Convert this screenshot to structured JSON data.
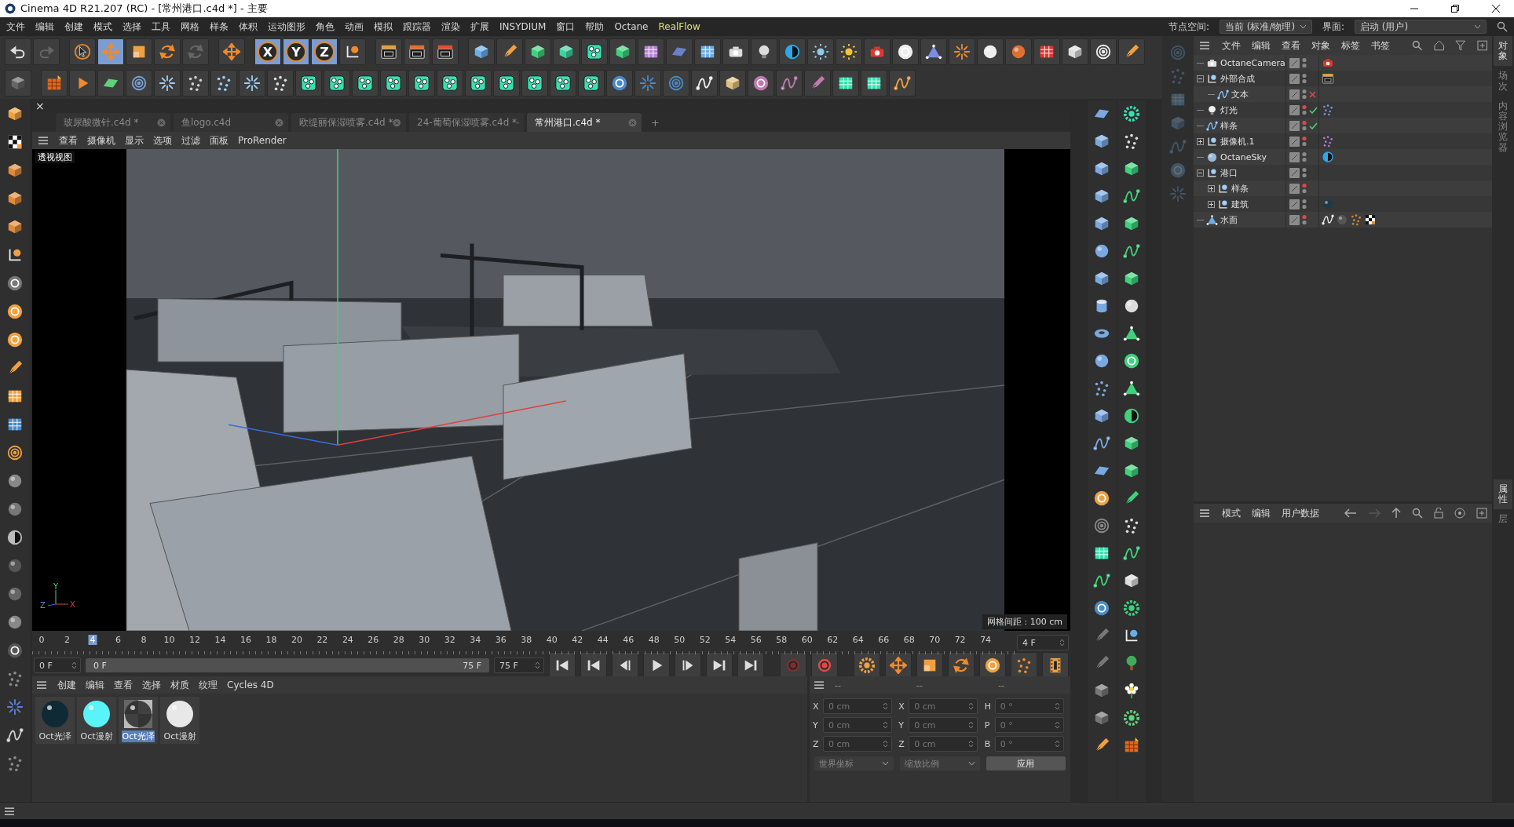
{
  "window": {
    "title": "Cinema 4D R21.207 (RC) - [常州港口.c4d *] - 主要"
  },
  "menu": [
    {
      "label": "文件"
    },
    {
      "label": "编辑"
    },
    {
      "label": "创建"
    },
    {
      "label": "模式"
    },
    {
      "label": "选择"
    },
    {
      "label": "工具"
    },
    {
      "label": "网格"
    },
    {
      "label": "样条"
    },
    {
      "label": "体积"
    },
    {
      "label": "运动图形"
    },
    {
      "label": "角色"
    },
    {
      "label": "动画"
    },
    {
      "label": "模拟"
    },
    {
      "label": "跟踪器"
    },
    {
      "label": "渲染"
    },
    {
      "label": "扩展"
    },
    {
      "label": "INSYDIUM"
    },
    {
      "label": "窗口"
    },
    {
      "label": "帮助"
    },
    {
      "label": "Octane"
    },
    {
      "label": "RealFlow",
      "color": "#d6e07e"
    }
  ],
  "node_space": {
    "label": "节点空间:",
    "value": "当前 (标准/物理)"
  },
  "layout": {
    "label": "界面:",
    "value": "启动 (用户)"
  },
  "transform_tools": [
    {
      "selected": false
    },
    {
      "selected": true
    },
    {
      "selected": false
    },
    {
      "selected": false
    }
  ],
  "axis_locks": [
    {
      "label": "X",
      "selected": true
    },
    {
      "label": "Y",
      "selected": true
    },
    {
      "label": "Z",
      "selected": true
    }
  ],
  "panel_close": "×",
  "file_tabs": [
    {
      "label": "玻尿酸微针.c4d *",
      "selected": false
    },
    {
      "label": "鱼logo.c4d",
      "selected": false
    },
    {
      "label": "欧缇丽保湿喷雾.c4d *",
      "selected": false
    },
    {
      "label": "24-葡萄保湿喷雾.c4d *",
      "selected": false
    },
    {
      "label": "常州港口.c4d *",
      "selected": true
    }
  ],
  "new_tab": "+",
  "viewport_menu": [
    "查看",
    "摄像机",
    "显示",
    "选项",
    "过滤",
    "面板",
    "ProRender"
  ],
  "viewport": {
    "label": "透视视图",
    "grid_spacing": "网格间距 : 100 cm",
    "axes": [
      "Y",
      "Z",
      "X"
    ]
  },
  "timeline": {
    "ticks": [
      {
        "label": "0",
        "selected": false
      },
      {
        "label": "2",
        "selected": false
      },
      {
        "label": "4",
        "selected": true
      },
      {
        "label": "6",
        "selected": false
      },
      {
        "label": "8",
        "selected": false
      },
      {
        "label": "10",
        "selected": false
      },
      {
        "label": "12",
        "selected": false
      },
      {
        "label": "14",
        "selected": false
      },
      {
        "label": "16",
        "selected": false
      },
      {
        "label": "18",
        "selected": false
      },
      {
        "label": "20",
        "selected": false
      },
      {
        "label": "22",
        "selected": false
      },
      {
        "label": "24",
        "selected": false
      },
      {
        "label": "26",
        "selected": false
      },
      {
        "label": "28",
        "selected": false
      },
      {
        "label": "30",
        "selected": false
      },
      {
        "label": "32",
        "selected": false
      },
      {
        "label": "34",
        "selected": false
      },
      {
        "label": "36",
        "selected": false
      },
      {
        "label": "38",
        "selected": false
      },
      {
        "label": "40",
        "selected": false
      },
      {
        "label": "42",
        "selected": false
      },
      {
        "label": "44",
        "selected": false
      },
      {
        "label": "46",
        "selected": false
      },
      {
        "label": "48",
        "selected": false
      },
      {
        "label": "50",
        "selected": false
      },
      {
        "label": "52",
        "selected": false
      },
      {
        "label": "54",
        "selected": false
      },
      {
        "label": "56",
        "selected": false
      },
      {
        "label": "58",
        "selected": false
      },
      {
        "label": "60",
        "selected": false
      },
      {
        "label": "62",
        "selected": false
      },
      {
        "label": "64",
        "selected": false
      },
      {
        "label": "66",
        "selected": false
      },
      {
        "label": "68",
        "selected": false
      },
      {
        "label": "70",
        "selected": false
      },
      {
        "label": "72",
        "selected": false
      },
      {
        "label": "74",
        "selected": false
      }
    ],
    "current_field": "4 F",
    "start_field": "0 F",
    "range": {
      "start": "0 F",
      "end": "75 F",
      "level": 1
    },
    "end_field": "75 F"
  },
  "materials_menu": [
    "创建",
    "编辑",
    "查看",
    "选择",
    "材质",
    "纹理",
    "Cycles 4D"
  ],
  "materials": [
    {
      "name": "Oct光泽",
      "kind": "dark-glossy",
      "selected": false
    },
    {
      "name": "Oct漫射",
      "kind": "cyan",
      "selected": false
    },
    {
      "name": "Oct光泽",
      "kind": "checker",
      "selected": true
    },
    {
      "name": "Oct漫射",
      "kind": "white",
      "selected": false
    }
  ],
  "coordinates": {
    "headers": [
      "--",
      "--",
      "--"
    ],
    "columns": [
      {
        "fields": [
          {
            "axis": "X",
            "value": "0 cm"
          },
          {
            "axis": "Y",
            "value": "0 cm"
          },
          {
            "axis": "Z",
            "value": "0 cm"
          }
        ]
      },
      {
        "fields": [
          {
            "axis": "X",
            "value": "0 cm"
          },
          {
            "axis": "Y",
            "value": "0 cm"
          },
          {
            "axis": "Z",
            "value": "0 cm"
          }
        ]
      },
      {
        "fields": [
          {
            "axis": "H",
            "value": "0 °"
          },
          {
            "axis": "P",
            "value": "0 °"
          },
          {
            "axis": "B",
            "value": "0 °"
          }
        ]
      }
    ],
    "disabled": true,
    "mode": "世界坐标",
    "scale_mode": "缩放比例",
    "apply": "应用"
  },
  "object_manager": {
    "menu": [
      "文件",
      "编辑",
      "查看",
      "对象",
      "标签",
      "书签"
    ],
    "objects": [
      {
        "name": "OctaneCamera",
        "kind": "camera",
        "visibility_off": false,
        "tags": [
          {
            "kind": "octane-camera"
          }
        ]
      },
      {
        "name": "外部合成",
        "kind": "null",
        "expanded": true,
        "visibility_off": false,
        "tags": [
          {
            "kind": "compositing"
          }
        ],
        "children": [
          {
            "name": "文本",
            "kind": "spline",
            "visibility_off": false,
            "enabled": false
          }
        ]
      },
      {
        "name": "灯光",
        "kind": "light",
        "visibility_off": true,
        "enabled": true,
        "tags": [
          {
            "kind": "target"
          }
        ]
      },
      {
        "name": "样条",
        "kind": "spline",
        "visibility_off": true,
        "enabled": true
      },
      {
        "name": "摄像机.1",
        "kind": "null",
        "expanded": false,
        "visibility_off": true,
        "tags": [
          {
            "kind": "protection"
          }
        ]
      },
      {
        "name": "OctaneSky",
        "kind": "sky",
        "visibility_off": false,
        "tags": [
          {
            "kind": "environment"
          }
        ]
      },
      {
        "name": "港口",
        "kind": "null",
        "expanded": true,
        "visibility_off": false,
        "children": [
          {
            "name": "样条",
            "kind": "null",
            "expanded": false,
            "visibility_off": true
          },
          {
            "name": "建筑",
            "kind": "null",
            "expanded": false,
            "visibility_off": false,
            "tags": [
              {
                "kind": "material-dark"
              }
            ]
          }
        ]
      },
      {
        "name": "水面",
        "kind": "terrain",
        "visibility_off": true,
        "tags": [
          {
            "kind": "vibrate"
          },
          {
            "kind": "material-noise"
          },
          {
            "kind": "spheres"
          },
          {
            "kind": "checker"
          }
        ]
      }
    ]
  },
  "attribute_manager": {
    "menu": [
      "模式",
      "编辑",
      "用户数据"
    ]
  },
  "side_tabs_top": [
    {
      "label": "对象",
      "selected": true
    },
    {
      "label": "场次",
      "selected": false
    },
    {
      "label": "内容浏览器",
      "selected": false
    }
  ],
  "side_tabs_bottom": [
    {
      "label": "属性",
      "selected": true
    },
    {
      "label": "层",
      "selected": false
    }
  ]
}
